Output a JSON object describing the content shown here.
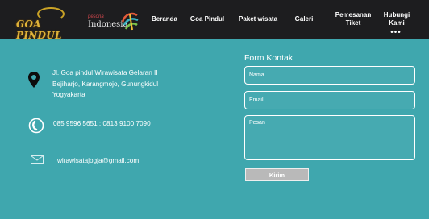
{
  "header": {
    "logo_text": "GOA PINDUL",
    "partner_logo": {
      "small": "pesona",
      "main": "Indonesia"
    },
    "nav": [
      {
        "label": "Beranda"
      },
      {
        "label": "Goa Pindul"
      },
      {
        "label": "Paket wisata"
      },
      {
        "label": "Galeri"
      },
      {
        "label": "Pemesanan\nTiket"
      },
      {
        "label": "Hubungi\nKami"
      }
    ],
    "more_dots": "•••"
  },
  "contact": {
    "address": "Jl. Goa pindul Wirawisata Gelaran II\nBejiharjo, Karangmojo, Gunungkidul\nYogyakarta",
    "phone": "085 9596 5651 ; 0813 9100 7090",
    "email": "wirawisatajogja@gmail.com"
  },
  "form": {
    "title": "Form Kontak",
    "name_placeholder": "Nama",
    "email_placeholder": "Email",
    "message_placeholder": "Pesan",
    "submit_label": "Kirim"
  },
  "colors": {
    "background": "#3fa7ae",
    "navbar": "#1d1d1f",
    "logo_gold": "#e0b33a",
    "button": "#b9b9b9"
  },
  "icons": {
    "address": "map-pin-icon",
    "phone": "phone-icon",
    "email": "mail-icon"
  }
}
